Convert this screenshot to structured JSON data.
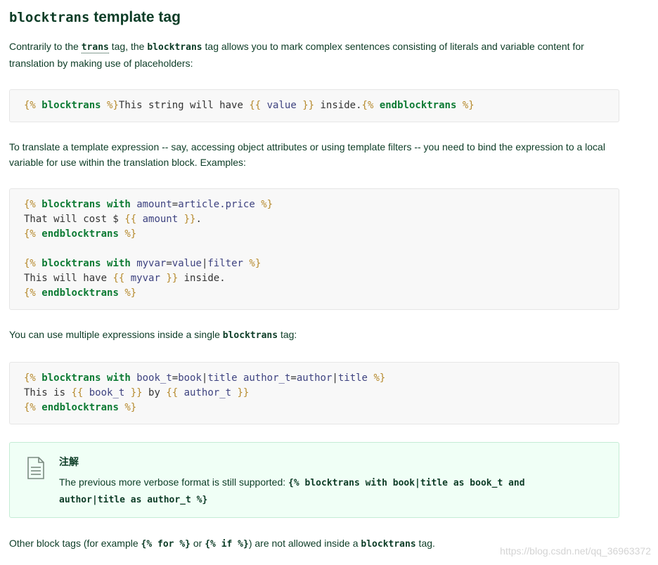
{
  "heading": {
    "code": "blocktrans",
    "text": " template tag"
  },
  "intro": {
    "t1": "Contrarily to the ",
    "code1": "trans",
    "t2": " tag, the ",
    "code2": "blocktrans",
    "t3": " tag allows you to mark complex sentences consisting of literals and variable content for translation by making use of placeholders:"
  },
  "code1": {
    "lines": [
      [
        {
          "t": "{%",
          "c": "tag"
        },
        {
          "t": " "
        },
        {
          "t": "blocktrans",
          "c": "kw"
        },
        {
          "t": " "
        },
        {
          "t": "%}",
          "c": "tag"
        },
        {
          "t": "This string will have "
        },
        {
          "t": "{{",
          "c": "tag"
        },
        {
          "t": " "
        },
        {
          "t": "value",
          "c": "var"
        },
        {
          "t": " "
        },
        {
          "t": "}}",
          "c": "tag"
        },
        {
          "t": " inside."
        },
        {
          "t": "{%",
          "c": "tag"
        },
        {
          "t": " "
        },
        {
          "t": "endblocktrans",
          "c": "kw"
        },
        {
          "t": " "
        },
        {
          "t": "%}",
          "c": "tag"
        }
      ]
    ]
  },
  "para2": "To translate a template expression -- say, accessing object attributes or using template filters -- you need to bind the expression to a local variable for use within the translation block. Examples:",
  "code2": {
    "lines": [
      [
        {
          "t": "{%",
          "c": "tag"
        },
        {
          "t": " "
        },
        {
          "t": "blocktrans",
          "c": "kw"
        },
        {
          "t": " "
        },
        {
          "t": "with",
          "c": "kw"
        },
        {
          "t": " "
        },
        {
          "t": "amount",
          "c": "var"
        },
        {
          "t": "="
        },
        {
          "t": "article.price",
          "c": "var"
        },
        {
          "t": " "
        },
        {
          "t": "%}",
          "c": "tag"
        }
      ],
      [
        {
          "t": "That will cost $ "
        },
        {
          "t": "{{",
          "c": "tag"
        },
        {
          "t": " "
        },
        {
          "t": "amount",
          "c": "var"
        },
        {
          "t": " "
        },
        {
          "t": "}}",
          "c": "tag"
        },
        {
          "t": "."
        }
      ],
      [
        {
          "t": "{%",
          "c": "tag"
        },
        {
          "t": " "
        },
        {
          "t": "endblocktrans",
          "c": "kw"
        },
        {
          "t": " "
        },
        {
          "t": "%}",
          "c": "tag"
        }
      ],
      [],
      [
        {
          "t": "{%",
          "c": "tag"
        },
        {
          "t": " "
        },
        {
          "t": "blocktrans",
          "c": "kw"
        },
        {
          "t": " "
        },
        {
          "t": "with",
          "c": "kw"
        },
        {
          "t": " "
        },
        {
          "t": "myvar",
          "c": "var"
        },
        {
          "t": "="
        },
        {
          "t": "value",
          "c": "var"
        },
        {
          "t": "|"
        },
        {
          "t": "filter",
          "c": "var"
        },
        {
          "t": " "
        },
        {
          "t": "%}",
          "c": "tag"
        }
      ],
      [
        {
          "t": "This will have "
        },
        {
          "t": "{{",
          "c": "tag"
        },
        {
          "t": " "
        },
        {
          "t": "myvar",
          "c": "var"
        },
        {
          "t": " "
        },
        {
          "t": "}}",
          "c": "tag"
        },
        {
          "t": " inside."
        }
      ],
      [
        {
          "t": "{%",
          "c": "tag"
        },
        {
          "t": " "
        },
        {
          "t": "endblocktrans",
          "c": "kw"
        },
        {
          "t": " "
        },
        {
          "t": "%}",
          "c": "tag"
        }
      ]
    ]
  },
  "para3": {
    "t1": "You can use multiple expressions inside a single ",
    "code": "blocktrans",
    "t2": " tag:"
  },
  "code3": {
    "lines": [
      [
        {
          "t": "{%",
          "c": "tag"
        },
        {
          "t": " "
        },
        {
          "t": "blocktrans",
          "c": "kw"
        },
        {
          "t": " "
        },
        {
          "t": "with",
          "c": "kw"
        },
        {
          "t": " "
        },
        {
          "t": "book_t",
          "c": "var"
        },
        {
          "t": "="
        },
        {
          "t": "book",
          "c": "var"
        },
        {
          "t": "|"
        },
        {
          "t": "title",
          "c": "var"
        },
        {
          "t": " "
        },
        {
          "t": "author_t",
          "c": "var"
        },
        {
          "t": "="
        },
        {
          "t": "author",
          "c": "var"
        },
        {
          "t": "|"
        },
        {
          "t": "title",
          "c": "var"
        },
        {
          "t": " "
        },
        {
          "t": "%}",
          "c": "tag"
        }
      ],
      [
        {
          "t": "This is "
        },
        {
          "t": "{{",
          "c": "tag"
        },
        {
          "t": " "
        },
        {
          "t": "book_t",
          "c": "var"
        },
        {
          "t": " "
        },
        {
          "t": "}}",
          "c": "tag"
        },
        {
          "t": " by "
        },
        {
          "t": "{{",
          "c": "tag"
        },
        {
          "t": " "
        },
        {
          "t": "author_t",
          "c": "var"
        },
        {
          "t": " "
        },
        {
          "t": "}}",
          "c": "tag"
        }
      ],
      [
        {
          "t": "{%",
          "c": "tag"
        },
        {
          "t": " "
        },
        {
          "t": "endblocktrans",
          "c": "kw"
        },
        {
          "t": " "
        },
        {
          "t": "%}",
          "c": "tag"
        }
      ]
    ]
  },
  "note": {
    "icon": "document-icon",
    "title": "注解",
    "text": "The previous more verbose format is still supported: ",
    "code1": "{% blocktrans with book|title as book_t and",
    "code2": "author|title as author_t %}"
  },
  "para4": {
    "t1": "Other block tags (for example ",
    "code1": "{% for %}",
    "t2": " or ",
    "code2": "{% if %}",
    "t3": ") are not allowed inside a ",
    "code3": "blocktrans",
    "t4": " tag."
  },
  "watermark": "https://blog.csdn.net/qq_36963372",
  "colors": {
    "text": "#0c3c26",
    "code_tag": "#b68a2d",
    "code_keyword": "#0d7b34",
    "code_variable": "#3e4380",
    "note_background": "#f0fff6"
  }
}
